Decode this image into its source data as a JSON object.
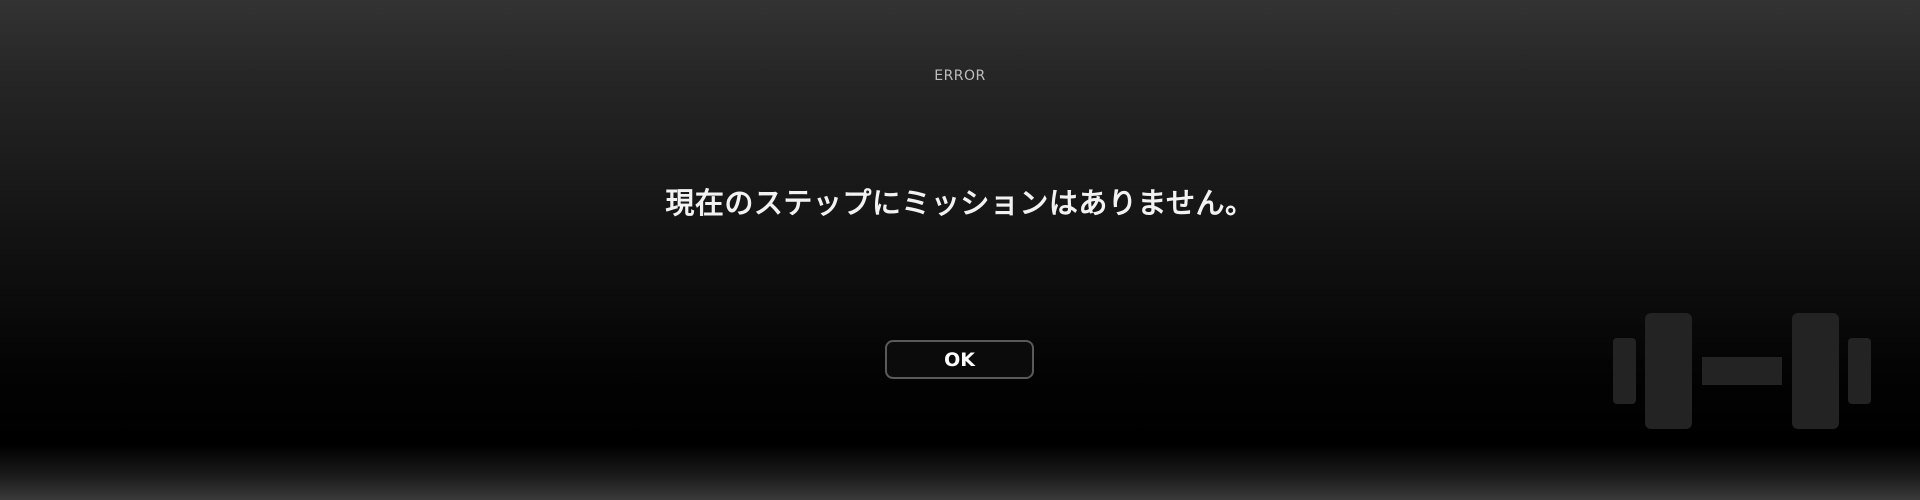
{
  "dialog": {
    "label": "ERROR",
    "message": "現在のステップにミッションはありません。",
    "ok_label": "OK"
  },
  "decoration": {
    "icon": "dumbbell-icon"
  }
}
